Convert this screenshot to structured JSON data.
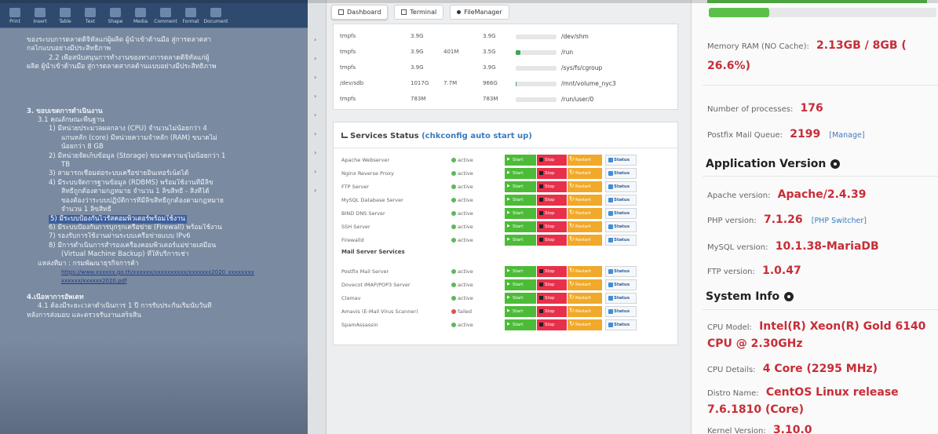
{
  "document": {
    "toolbar": [
      "Print",
      "Insert",
      "Table",
      "Text",
      "Shape",
      "Media",
      "Comment",
      "Format",
      "Document"
    ],
    "paragraphs": [
      {
        "text": "ของระบบการตลาดดิจิทัลแก่ผู้ผลิต ผู้นำเข้าด้านมือ สู่การตลาดสา",
        "cls": ""
      },
      {
        "text": "กลไกแบบอย่างมีประสิทธิภาพ",
        "cls": ""
      },
      {
        "text": "2.2 เพื่อสนับสนุนการทำงานของทางการตลาดดิจิทัลแก่ผู้",
        "cls": "ind2"
      },
      {
        "text": "ผลิต ผู้นำเข้าด้านมือ สู่การตลาดสากลด้านแบบอย่างมีประสิทธิภาพ",
        "cls": ""
      },
      {
        "text": "",
        "cls": "gap"
      },
      {
        "text": "",
        "cls": "gap"
      },
      {
        "text": "",
        "cls": "gap"
      },
      {
        "text": "",
        "cls": "gap"
      },
      {
        "text": "",
        "cls": "gap"
      },
      {
        "text": "3. ขอบเขตการดำเนินงาน",
        "cls": "bold"
      },
      {
        "text": "3.1 คุณลักษณะพื้นฐาน",
        "cls": "ind1"
      },
      {
        "text": "1) มีหน่วยประมวลผลกลาง (CPU) จำนวนไม่น้อยกว่า 4",
        "cls": "ind2"
      },
      {
        "text": "แกนหลัก (core) มีหน่วยความจำหลัก (RAM) ขนาดไม่",
        "cls": "ind3"
      },
      {
        "text": "น้อยกว่า 8 GB",
        "cls": "ind3"
      },
      {
        "text": "2) มีหน่วยจัดเก็บข้อมูล (Storage) ขนาดความจุไม่น้อยกว่า 1",
        "cls": "ind2"
      },
      {
        "text": "TB",
        "cls": "ind3"
      },
      {
        "text": "3) สามารถเชื่อมต่อระบบเครือข่ายอินเทอร์เน็ตได้",
        "cls": "ind2"
      },
      {
        "text": "4) มีระบบจัดการฐานข้อมูล (RDBMS) พร้อมใช้งานที่มีลิข",
        "cls": "ind2"
      },
      {
        "text": "สิทธิ์ถูกต้องตามกฎหมาย จำนวน 1 ลิขสิทธิ์ - สิ่งที่ได้",
        "cls": "ind3"
      },
      {
        "text": "ของต้องว่าระบบปฏิบัติการที่มีลิขสิทธิ์ถูกต้องตามกฎหมาย",
        "cls": "ind3"
      },
      {
        "text": "จำนวน 1 ลิขสิทธิ์",
        "cls": "ind3"
      },
      {
        "text": "5) มีระบบป้องกันไวรัสคอมพิวเตอร์พร้อมใช้งาน",
        "cls": "ind2 hlrow"
      },
      {
        "text": "6) มีระบบป้องกันการบุกรุกเครือข่าย (Firewall) พร้อมใช้งาน",
        "cls": "ind2"
      },
      {
        "text": "7) รองรับการใช้งานผ่านระบบเครือข่ายแบบ IPv6",
        "cls": "ind2"
      },
      {
        "text": "8) มีการดำเนินการสำรองเครื่องคอมพิวเตอร์แม่ข่ายเสมือน",
        "cls": "ind2"
      },
      {
        "text": "(Virtual Machine Backup) ที่ให้บริการเช่า",
        "cls": "ind3"
      },
      {
        "text": "แหล่งที่มา : กรมพัฒนาธุรกิจการค้า",
        "cls": "ind1"
      }
    ],
    "links": [
      "https://www.xxxxxx.go.th/xxxxxx/xxxxxxxxxx/xxxxxxx2020_xxxxxxxx",
      "xxxxxx/xxxxxx2020.pdf"
    ],
    "footer": [
      {
        "text": "4.เนื้อหาการอัพเดท",
        "cls": "bold"
      },
      {
        "text": "4.1 ต้องมีระยะเวลาดำเนินการ 1 ปี การรับประกันเริ่มนับวันที่",
        "cls": "ind1"
      },
      {
        "text": "หลังการส่งมอบ และตรวจรับงานเสร็จสิ้น",
        "cls": ""
      }
    ]
  },
  "dashboard": {
    "tabs": [
      "Dashboard",
      "Terminal",
      "FileManager"
    ],
    "filesystems": [
      {
        "type": "tmpfs",
        "size": "3.9G",
        "used": "",
        "avail": "3.9G",
        "use_pct": 0,
        "mount": "/dev/shm"
      },
      {
        "type": "tmpfs",
        "size": "3.9G",
        "used": "401M",
        "avail": "3.5G",
        "use_pct": 11,
        "mount": "/run"
      },
      {
        "type": "tmpfs",
        "size": "3.9G",
        "used": "",
        "avail": "3.9G",
        "use_pct": 0,
        "mount": "/sys/fs/cgroup"
      },
      {
        "type": "/dev/sdb",
        "size": "1017G",
        "used": "7.7M",
        "avail": "966G",
        "use_pct": 1,
        "mount": "/mnt/volume_nyc3"
      },
      {
        "type": "tmpfs",
        "size": "783M",
        "used": "",
        "avail": "783M",
        "use_pct": 0,
        "mount": "/run/user/0"
      }
    ],
    "services_title": "Services Status",
    "services_link": "(chkconfig auto start up)",
    "button_labels": {
      "start": "Start",
      "stop": "Stop",
      "restart": "Restart",
      "status": "Status"
    },
    "services": [
      {
        "name": "Apache Webserver",
        "state": "active",
        "fail": false
      },
      {
        "name": "Nginx Reverse Proxy",
        "state": "active",
        "fail": false
      },
      {
        "name": "FTP Server",
        "state": "active",
        "fail": false
      },
      {
        "name": "MySQL Database Server",
        "state": "active",
        "fail": false
      },
      {
        "name": "BIND DNS Server",
        "state": "active",
        "fail": false
      },
      {
        "name": "SSH Server",
        "state": "active",
        "fail": false
      },
      {
        "name": "Firewalld",
        "state": "active",
        "fail": false
      }
    ],
    "mail_heading": "Mail Server Services",
    "mail_services": [
      {
        "name": "Postfix Mail Server",
        "state": "active",
        "fail": false
      },
      {
        "name": "Dovecot IMAP/POP3 Server",
        "state": "active",
        "fail": false
      },
      {
        "name": "Clamav",
        "state": "active",
        "fail": false
      },
      {
        "name": "Amavis (E-Mail Virus Scanner)",
        "state": "failed",
        "fail": true
      },
      {
        "name": "SpamAssassin",
        "state": "active",
        "fail": false
      }
    ]
  },
  "info": {
    "memory_label": "Memory RAM (NO Cache):",
    "memory_value": "2.13GB / 8GB (26.6%)",
    "memory_pct": 26.6,
    "processes_label": "Number of processes:",
    "processes_value": "176",
    "postfix_label": "Postfix Mail Queue:",
    "postfix_value": "2199",
    "postfix_link": "[Manage]",
    "app_heading": "Application Version",
    "apache_label": "Apache version:",
    "apache_value": "Apache/2.4.39",
    "php_label": "PHP version:",
    "php_value": "7.1.26",
    "php_link": "[PHP Switcher]",
    "mysql_label": "MySQL version:",
    "mysql_value": "10.1.38-MariaDB",
    "ftp_label": "FTP version:",
    "ftp_value": "1.0.47",
    "sys_heading": "System Info",
    "cpu_model_label": "CPU Model:",
    "cpu_model_value": "Intel(R) Xeon(R) Gold 6140 CPU @ 2.30GHz",
    "cpu_details_label": "CPU Details:",
    "cpu_details_value": "4 Core (2295 MHz)",
    "distro_label": "Distro Name:",
    "distro_value": "CentOS Linux release 7.6.1810 (Core)",
    "kernel_label": "Kernel Version:",
    "kernel_value": "3.10.0"
  },
  "colors": {
    "accent_red": "#c72d37",
    "link_blue": "#3b7bbf",
    "start_green": "#4cbc38",
    "stop_red": "#e8304a",
    "restart_orange": "#f0a92a"
  }
}
